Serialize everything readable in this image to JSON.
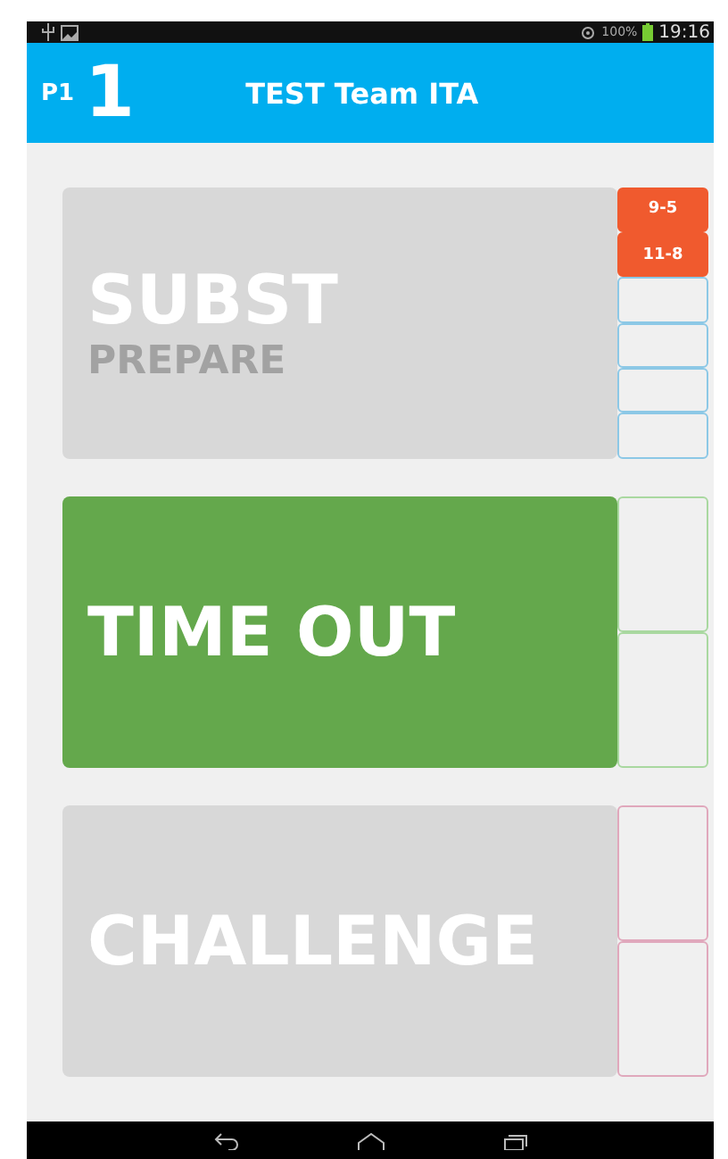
{
  "status_bar": {
    "battery": "100%",
    "time": "19:16"
  },
  "header": {
    "player": "P1",
    "number": "1",
    "team": "TEST Team ITA"
  },
  "panels": [
    {
      "title": "SUBST",
      "subtitle": "PREPARE",
      "active": false,
      "color": "#8cc8e6",
      "slots": [
        {
          "label": "9-5",
          "used": true
        },
        {
          "label": "11-8",
          "used": true
        },
        {
          "used": false
        },
        {
          "used": false
        },
        {
          "used": false
        },
        {
          "used": false
        }
      ]
    },
    {
      "title": "TIME OUT",
      "active": true,
      "color": "#a9d8a0",
      "slots": [
        {
          "used": false
        },
        {
          "used": false
        }
      ]
    },
    {
      "title": "CHALLENGE",
      "active": false,
      "color": "#e0a8bc",
      "slots": [
        {
          "used": false
        },
        {
          "used": false
        }
      ]
    }
  ]
}
